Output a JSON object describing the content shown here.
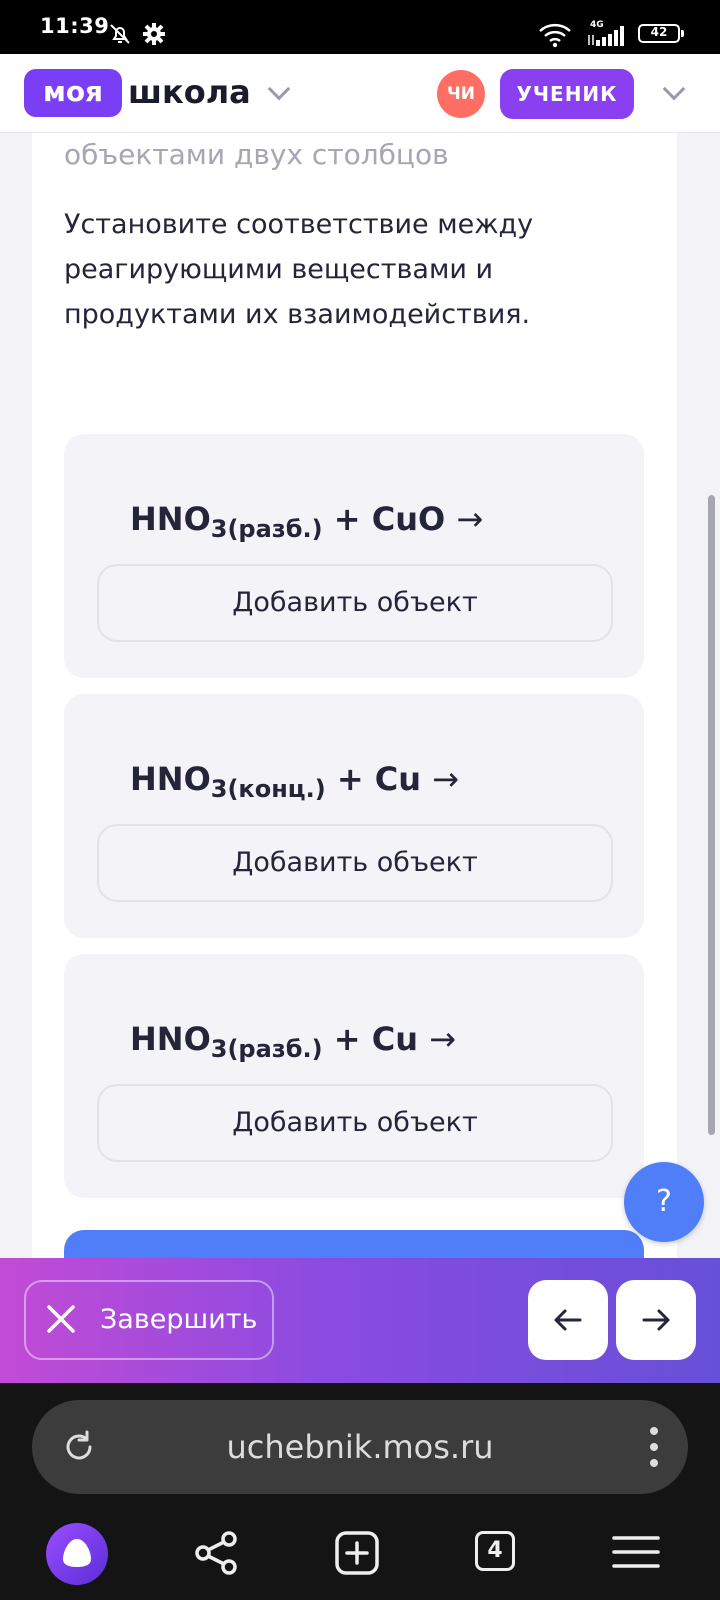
{
  "status_bar": {
    "time": "11:39",
    "network": "4G",
    "battery": "42"
  },
  "header": {
    "logo_part1": "моя",
    "logo_part2": "школа",
    "avatar_initials": "ЧИ",
    "role": "УЧЕНИК"
  },
  "content": {
    "subtitle": "объектами двух столбцов",
    "task": "Установите соответствие между реагирующими веществами и продуктами их взаимодействия.",
    "items": [
      {
        "formula": "HNO",
        "index": "3(разб.)",
        "rest": "+ CuO",
        "arrow": "→",
        "button": "Добавить объект"
      },
      {
        "formula": "HNO",
        "index": "3(конц.)",
        "rest": "+ Cu",
        "arrow": "→",
        "button": "Добавить объект"
      },
      {
        "formula": "HNO",
        "index": "3(разб.)",
        "rest": "+ Cu",
        "arrow": "→",
        "button": "Добавить объект"
      }
    ],
    "help_label": "?"
  },
  "action_bar": {
    "finish_label": "Завершить"
  },
  "browser": {
    "url": "uchebnik.mos.ru",
    "tab_count": "4"
  },
  "colors": {
    "brand_purple": "#7a3ff5",
    "role_purple": "#8a3ff0",
    "avatar": "#ff6e63",
    "help_blue": "#4f7ef8"
  }
}
